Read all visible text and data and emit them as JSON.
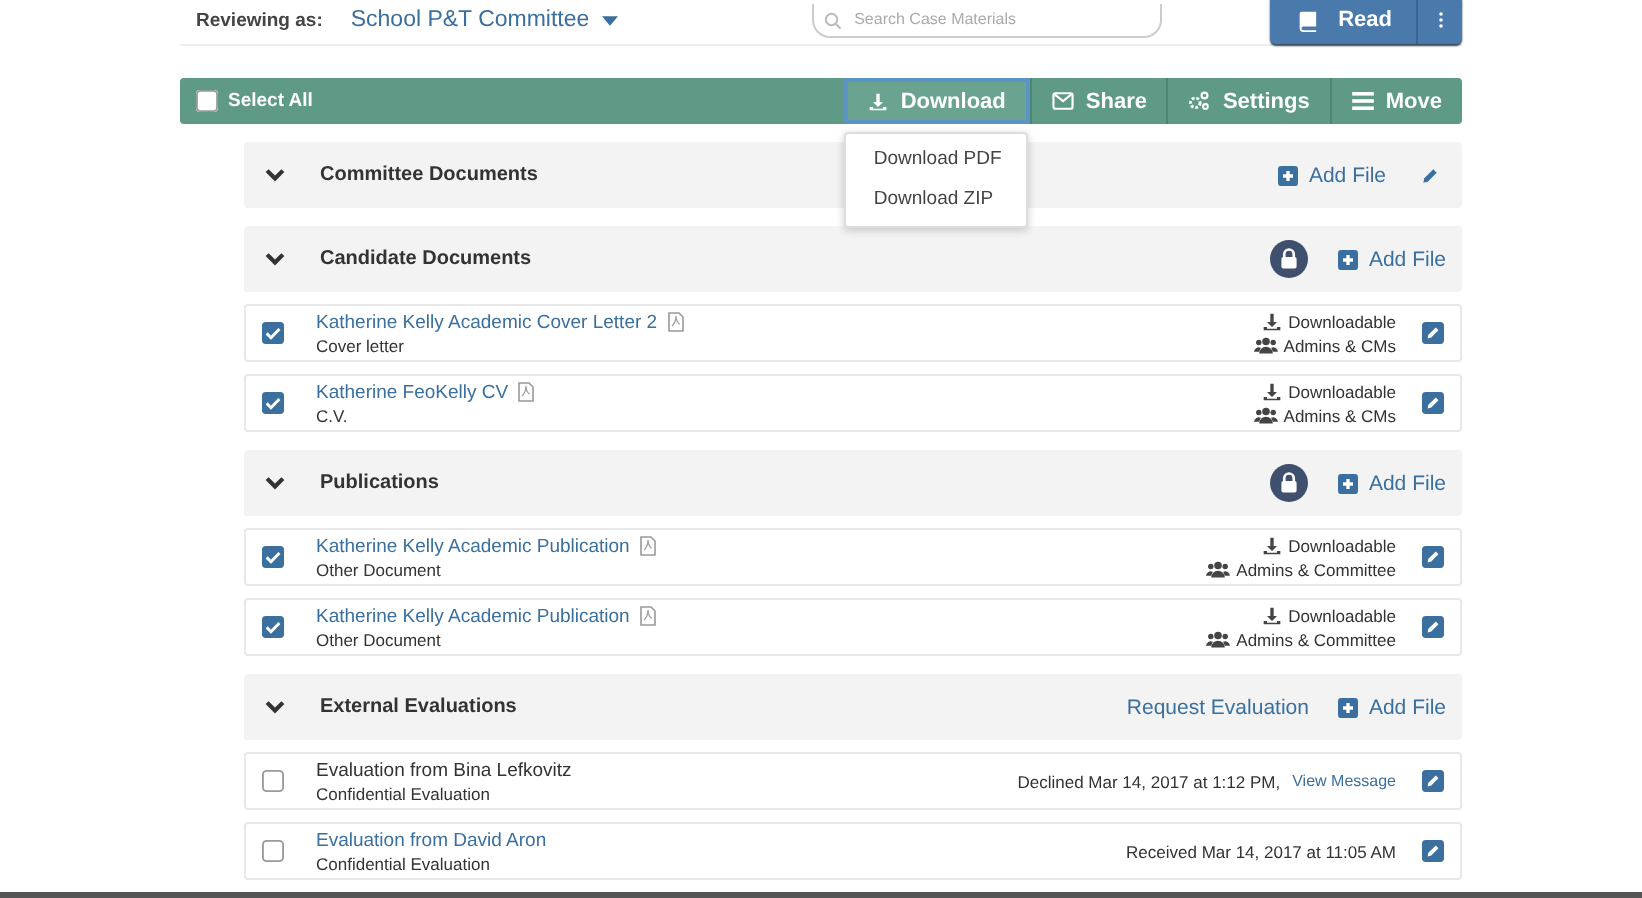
{
  "header": {
    "reviewing_label": "Reviewing as:",
    "committee": "School P&T Committee",
    "search": {
      "placeholder": "Search Case Materials"
    },
    "read_button": "Read"
  },
  "toolbar": {
    "select_all": {
      "label": "Select All",
      "checked": false
    },
    "buttons": [
      {
        "kind": "download",
        "label": "Download",
        "selected": true
      },
      {
        "kind": "share",
        "label": "Share",
        "selected": false
      },
      {
        "kind": "settings",
        "label": "Settings",
        "selected": false
      },
      {
        "kind": "move",
        "label": "Move",
        "selected": false
      }
    ]
  },
  "dropdown": {
    "items": [
      "Download PDF",
      "Download ZIP"
    ]
  },
  "sections": [
    {
      "title": "Committee Documents",
      "expanded": true,
      "locked": false,
      "editable": true,
      "actions": [
        {
          "kind": "add",
          "label": "Add File"
        }
      ]
    },
    {
      "title": "Candidate Documents",
      "expanded": true,
      "locked": true,
      "editable": false,
      "actions": [
        {
          "kind": "add",
          "label": "Add File"
        }
      ],
      "files": [
        {
          "kind": "document",
          "title": "Katherine Kelly Academic Cover Letter 2",
          "subtitle": "Cover letter",
          "checked": true,
          "status": [
            "Downloadable",
            "Admins & CMs"
          ]
        },
        {
          "kind": "document",
          "title": "Katherine FeoKelly CV",
          "subtitle": "C.V.",
          "checked": true,
          "status": [
            "Downloadable",
            "Admins & CMs"
          ]
        }
      ]
    },
    {
      "title": "Publications",
      "expanded": true,
      "locked": true,
      "editable": false,
      "actions": [
        {
          "kind": "add",
          "label": "Add File"
        }
      ],
      "files": [
        {
          "kind": "document",
          "title": "Katherine Kelly Academic Publication",
          "subtitle": "Other Document",
          "checked": true,
          "status": [
            "Downloadable",
            "Admins & Committee"
          ]
        },
        {
          "kind": "document",
          "title": "Katherine Kelly Academic Publication",
          "subtitle": "Other Document",
          "checked": true,
          "status": [
            "Downloadable",
            "Admins & Committee"
          ]
        }
      ]
    },
    {
      "title": "External Evaluations",
      "expanded": true,
      "locked": false,
      "editable": false,
      "actions": [
        {
          "kind": "link",
          "label": "Request Evaluation"
        },
        {
          "kind": "add",
          "label": "Add File"
        }
      ],
      "files": [
        {
          "kind": "evaluation",
          "title": "Evaluation from Bina Lefkovitz",
          "subtitle": "Confidential Evaluation",
          "checked": false,
          "linked": false,
          "status_text": "Declined Mar 14, 2017 at 1:12 PM,",
          "status_link": "View Message"
        },
        {
          "kind": "evaluation",
          "title": "Evaluation from David Aron",
          "subtitle": "Confidential Evaluation",
          "checked": false,
          "linked": true,
          "status_text": "Received Mar 14, 2017 at 11:05 AM"
        }
      ]
    }
  ]
}
